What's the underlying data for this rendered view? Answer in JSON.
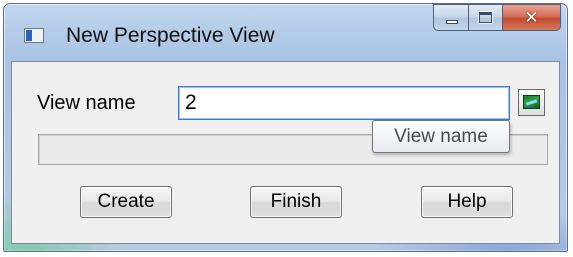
{
  "window": {
    "title": "New Perspective View",
    "controls": {
      "minimize": "minimize",
      "maximize": "maximize",
      "close": "close"
    }
  },
  "form": {
    "view_name_label": "View name",
    "view_name_value": "2",
    "picker_icon": "view-select-icon"
  },
  "tooltip": {
    "text": "View name"
  },
  "buttons": {
    "create": "Create",
    "finish": "Finish",
    "help": "Help"
  },
  "colors": {
    "close_button": "#c14a31",
    "title_bar": "#b3cbe8",
    "client_bg": "#f0f0f0"
  }
}
